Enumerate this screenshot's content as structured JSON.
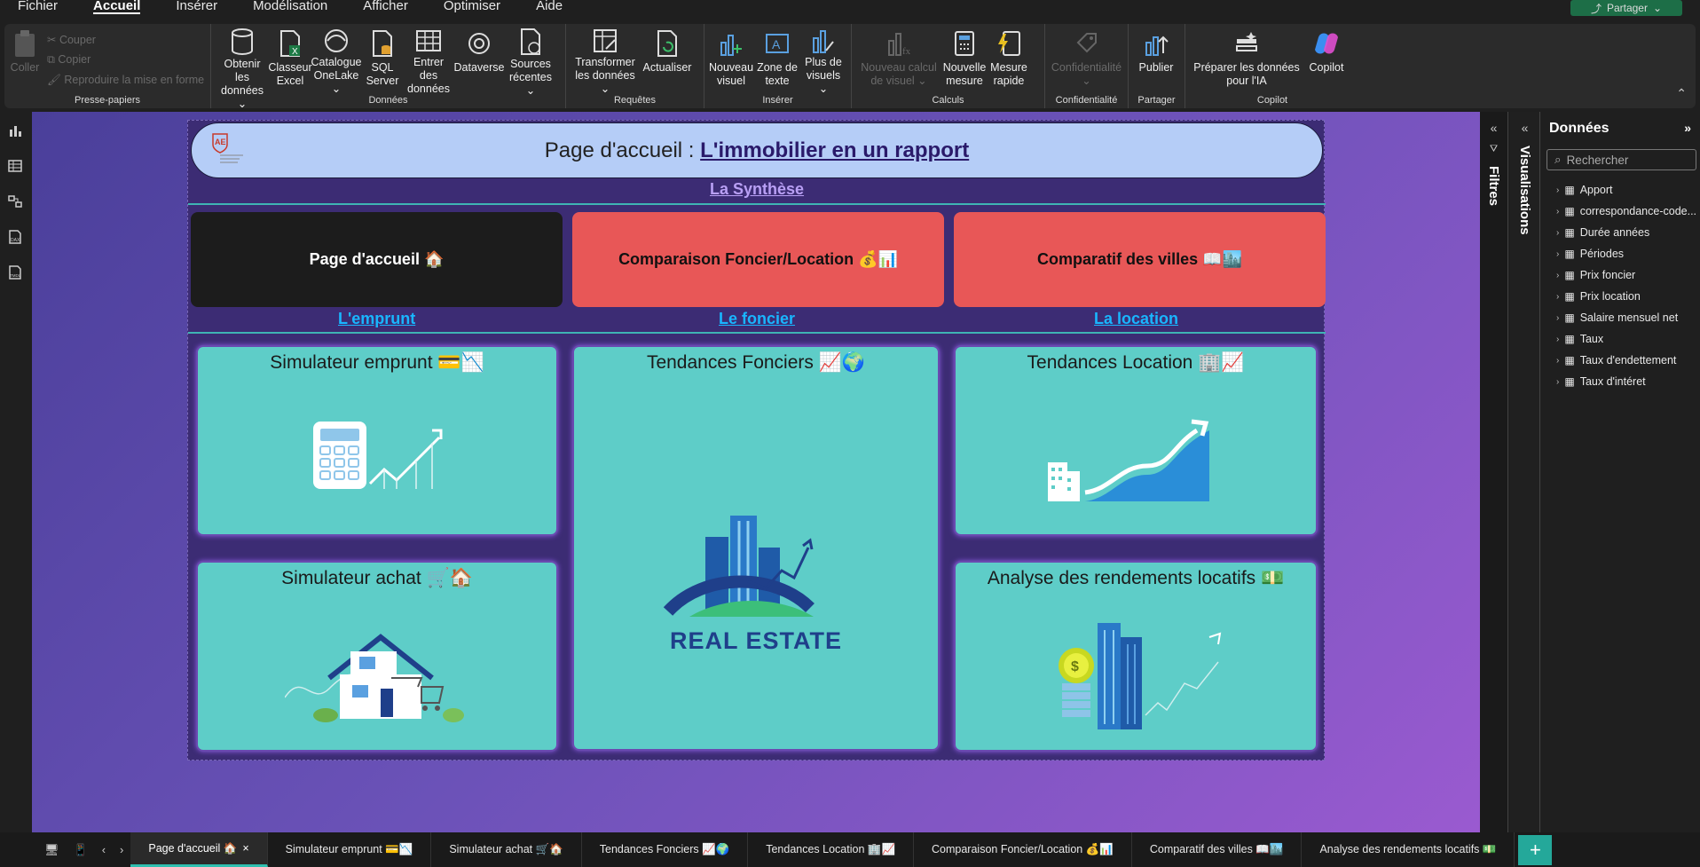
{
  "menu": {
    "items": [
      "Fichier",
      "Accueil",
      "Insérer",
      "Modélisation",
      "Afficher",
      "Optimiser",
      "Aide"
    ],
    "active": "Accueil",
    "share_label": "Partager"
  },
  "ribbon": {
    "clipboard": {
      "label": "Presse-papiers",
      "paste": "Coller",
      "cut": "Couper",
      "copy": "Copier",
      "format_painter": "Reproduire la mise en forme"
    },
    "data": {
      "label": "Données",
      "buttons": [
        "Obtenir les données ⌄",
        "Classeur Excel",
        "Catalogue OneLake ⌄",
        "SQL Server",
        "Entrer des données",
        "Dataverse",
        "Sources récentes ⌄"
      ]
    },
    "queries": {
      "label": "Requêtes",
      "buttons": [
        "Transformer les données ⌄",
        "Actualiser"
      ]
    },
    "insert": {
      "label": "Insérer",
      "buttons": [
        "Nouveau visuel",
        "Zone de texte",
        "Plus de visuels ⌄"
      ]
    },
    "calc": {
      "label": "Calculs",
      "buttons": [
        "Nouveau calcul de visuel ⌄",
        "Nouvelle mesure",
        "Mesure rapide"
      ]
    },
    "confidential": {
      "label": "Confidentialité",
      "buttons": [
        "Confidentialité ⌄"
      ]
    },
    "share": {
      "label": "Partager",
      "buttons": [
        "Publier"
      ]
    },
    "copilot": {
      "label": "Copilot",
      "buttons": [
        "Préparer les données pour l'IA",
        "Copilot"
      ]
    }
  },
  "report": {
    "header_prefix": "Page d'accueil : ",
    "header_bold": "L'immobilier en un rapport",
    "synthese": "La Synthèse",
    "nav": [
      "Page d'accueil 🏠",
      "Comparaison Foncier/Location 💰📊",
      "Comparatif des villes 📖🏙️"
    ],
    "sections": [
      "L'emprunt",
      "Le foncier",
      "La location"
    ],
    "cards": {
      "sim_emprunt": "Simulateur emprunt 💳📉",
      "tendances_fonciers": "Tendances Fonciers 📈🌍",
      "tendances_location": "Tendances Location 🏢📈",
      "sim_achat": "Simulateur achat 🛒🏠",
      "rendements": "Analyse des rendements locatifs 💵",
      "real_estate": "REAL ESTATE"
    }
  },
  "panes": {
    "filters": "Filtres",
    "visualisations": "Visualisations",
    "data_title": "Données",
    "search_placeholder": "Rechercher",
    "tables": [
      "Apport",
      "correspondance-code...",
      "Durée années",
      "Périodes",
      "Prix foncier",
      "Prix location",
      "Salaire mensuel net",
      "Taux",
      "Taux d'endettement",
      "Taux d'intéret"
    ]
  },
  "tabs": [
    "Page d'accueil 🏠",
    "Simulateur emprunt 💳📉",
    "Simulateur achat 🛒🏠",
    "Tendances Fonciers 📈🌍",
    "Tendances Location 🏢📈",
    "Comparaison Foncier/Location 💰📊",
    "Comparatif des villes 📖🏙️",
    "Analyse des rendements locatifs 💵"
  ],
  "colors": {
    "accent_teal": "#5ecdc8",
    "nav_red": "#e85757",
    "link_blue": "#19b6ff",
    "header_blue": "#b5cdf7"
  }
}
